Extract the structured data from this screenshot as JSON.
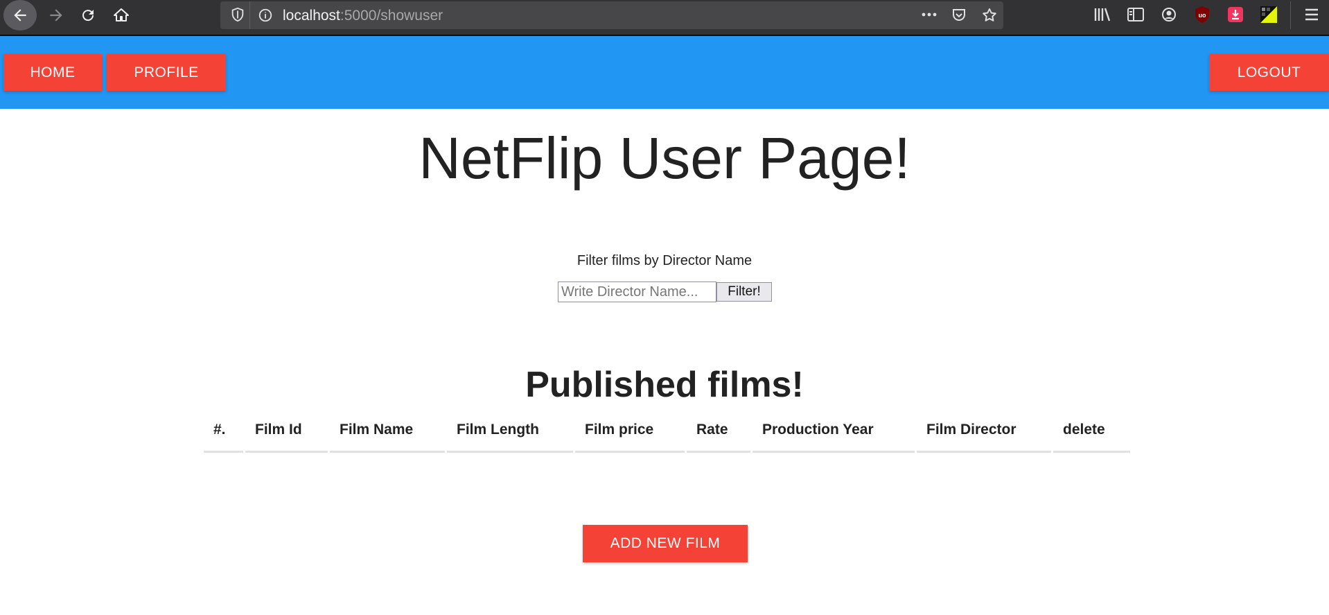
{
  "browser": {
    "url_host": "localhost",
    "url_path": ":5000/showuser"
  },
  "nav": {
    "home_label": "HOME",
    "profile_label": "PROFILE",
    "logout_label": "LOGOUT"
  },
  "page": {
    "title": "NetFlip User Page!"
  },
  "filter": {
    "label": "Filter films by Director Name",
    "placeholder": "Write Director Name...",
    "button_label": "Filter!"
  },
  "films": {
    "title": "Published films!",
    "columns": [
      "#.",
      "Film Id",
      "Film Name",
      "Film Length",
      "Film price",
      "Rate",
      "Production Year",
      "Film Director",
      "delete"
    ],
    "rows": [],
    "add_button_label": "ADD NEW FILM"
  },
  "colors": {
    "header_bg": "#2196f3",
    "button_bg": "#f44336"
  }
}
